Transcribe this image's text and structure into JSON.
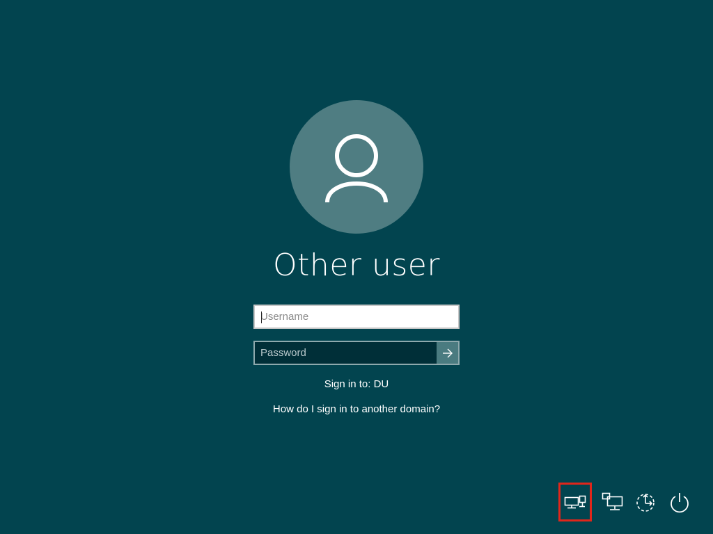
{
  "user": {
    "name": "Other user"
  },
  "username_field": {
    "placeholder": "Username",
    "value": ""
  },
  "password_field": {
    "placeholder": "Password",
    "value": ""
  },
  "submit_icon": "arrow-right-icon",
  "sign_in_to": "Sign in to: DU",
  "help_link": "How do I sign in to another domain?",
  "tray": {
    "items": [
      {
        "name": "ease-of-access",
        "icon": "other-user-monitors-icon",
        "selected": true
      },
      {
        "name": "network",
        "icon": "network-icon",
        "selected": false
      },
      {
        "name": "accessibility",
        "icon": "accessibility-icon",
        "selected": false
      },
      {
        "name": "power",
        "icon": "power-icon",
        "selected": false
      }
    ]
  },
  "colors": {
    "background": "#02444f",
    "avatar": "#4f7d82",
    "selection_outline": "#e0261b"
  }
}
